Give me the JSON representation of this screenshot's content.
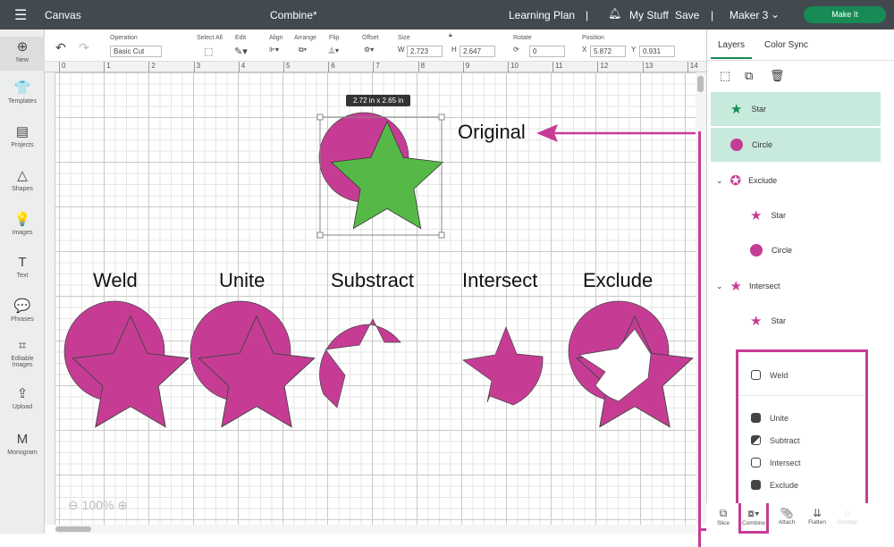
{
  "header": {
    "menu_icon": "hamburger-icon",
    "app": "Canvas",
    "title": "Combine*",
    "learning": "Learning Plan",
    "sep": "|",
    "bell_icon": "bell-icon",
    "mystuff": "My Stuff",
    "save": "Save",
    "machine": "Maker 3",
    "make_it": "Make It"
  },
  "sidebar": {
    "items": [
      {
        "label": "New",
        "icon": "⊕"
      },
      {
        "label": "Templates",
        "icon": "👕"
      },
      {
        "label": "Projects",
        "icon": "▤"
      },
      {
        "label": "Shapes",
        "icon": "△"
      },
      {
        "label": "Images",
        "icon": "💡"
      },
      {
        "label": "Text",
        "icon": "T"
      },
      {
        "label": "Phrases",
        "icon": "💬"
      },
      {
        "label": "Editable Images",
        "icon": "⌗"
      },
      {
        "label": "Upload",
        "icon": "⇪"
      },
      {
        "label": "Monogram",
        "icon": "M"
      }
    ]
  },
  "toolbar": {
    "operation_label": "Operation",
    "operation_value": "Basic Cut",
    "select_all": "Select All",
    "edit": "Edit",
    "align": "Align",
    "arrange": "Arrange",
    "flip": "Flip",
    "offset": "Offset",
    "size": "Size",
    "w_label": "W",
    "w": "2.723",
    "h_label": "H",
    "h": "2.647",
    "rotate": "Rotate",
    "rotate_value": "0",
    "position": "Position",
    "x_label": "X",
    "x": "5.872",
    "y_label": "Y",
    "y": "0.931"
  },
  "ruler": [
    "0",
    "1",
    "2",
    "3",
    "4",
    "5",
    "6",
    "7",
    "8",
    "9",
    "10",
    "11",
    "12",
    "13",
    "14"
  ],
  "canvas": {
    "size_tooltip": "2.72  in x 2.65  in",
    "original": "Original",
    "labels": [
      "Weld",
      "Unite",
      "Substract",
      "Intersect",
      "Exclude"
    ],
    "zoom": "100%"
  },
  "colors": {
    "magenta": "#c63c95",
    "green": "#56b947",
    "accent": "#178a55",
    "selected": "#c7eadc"
  },
  "panel": {
    "tabs": [
      "Layers",
      "Color Sync"
    ],
    "layers": [
      {
        "name": "Star",
        "type": "star",
        "selected": true
      },
      {
        "name": "Circle",
        "type": "circle",
        "selected": true
      },
      {
        "name": "Exclude",
        "type": "group"
      },
      {
        "name": "Star",
        "type": "star"
      },
      {
        "name": "Circle",
        "type": "circle"
      },
      {
        "name": "Intersect",
        "type": "group"
      },
      {
        "name": "Star",
        "type": "star"
      }
    ]
  },
  "combine_menu": {
    "items": [
      "Weld",
      "Unite",
      "Subtract",
      "Intersect",
      "Exclude"
    ]
  },
  "bottom": {
    "items": [
      "Slice",
      "Combine",
      "Attach",
      "Flatten",
      "Contour"
    ]
  }
}
